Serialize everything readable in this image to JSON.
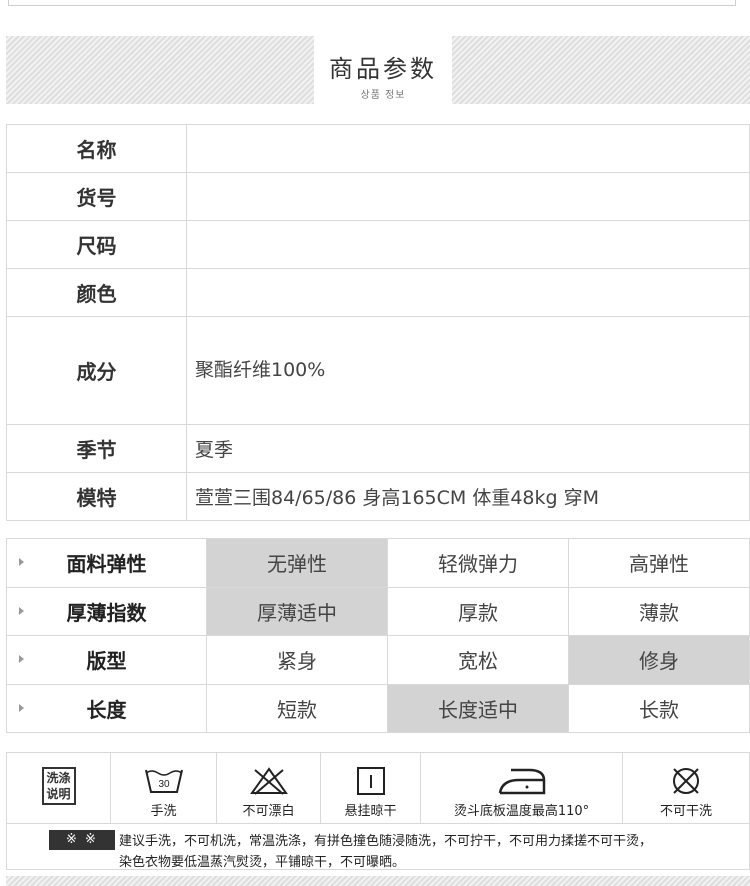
{
  "header": {
    "title": "商品参数",
    "subtitle": "상품 정보"
  },
  "info_rows": [
    {
      "label": "名称",
      "value": ""
    },
    {
      "label": "货号",
      "value": ""
    },
    {
      "label": "尺码",
      "value": ""
    },
    {
      "label": "颜色",
      "value": ""
    },
    {
      "label": "成分",
      "value": "聚酯纤维100%"
    },
    {
      "label": "季节",
      "value": "夏季"
    },
    {
      "label": "模特",
      "value": "萱萱三围84/65/86 身高165CM 体重48kg 穿M"
    }
  ],
  "attributes": [
    {
      "name": "面料弹性",
      "options": [
        "无弹性",
        "轻微弹力",
        "高弹性"
      ],
      "selected": 0
    },
    {
      "name": "厚薄指数",
      "options": [
        "厚薄适中",
        "厚款",
        "薄款"
      ],
      "selected": 0
    },
    {
      "name": "版型",
      "options": [
        "紧身",
        "宽松",
        "修身"
      ],
      "selected": 2
    },
    {
      "name": "长度",
      "options": [
        "短款",
        "长度适中",
        "长款"
      ],
      "selected": 1
    }
  ],
  "care": {
    "legend": [
      "洗涤",
      "说明"
    ],
    "items": [
      {
        "icon": "hand-wash-30-icon",
        "label": "手洗",
        "temp": "30"
      },
      {
        "icon": "no-bleach-icon",
        "label": "不可漂白"
      },
      {
        "icon": "hang-dry-icon",
        "label": "悬挂晾干"
      },
      {
        "icon": "iron-icon",
        "label": "烫斗底板温度最高110°"
      },
      {
        "icon": "no-dry-clean-icon",
        "label": "不可干洗"
      }
    ],
    "note_badge": "※ ※",
    "note_line1": "建议手洗，不可机洗，常温洗涤，有拼色撞色随浸随洗，不可拧干，不可用力揉搓不可干烫，",
    "note_line2": "染色衣物要低温蒸汽熨烫，平铺晾干，不可曝晒。"
  }
}
